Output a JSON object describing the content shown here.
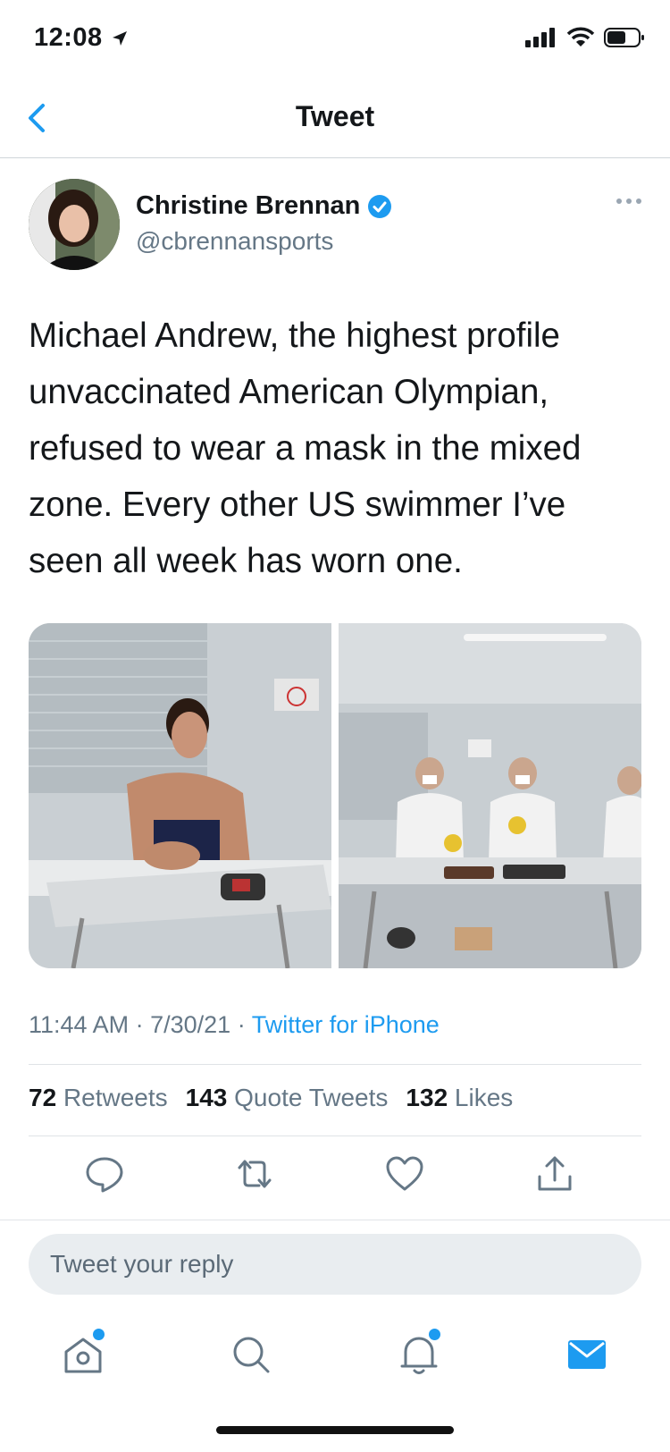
{
  "status_bar": {
    "time": "12:08"
  },
  "nav": {
    "title": "Tweet"
  },
  "author": {
    "name": "Christine Brennan",
    "handle": "@cbrennansports",
    "verified": true
  },
  "tweet": {
    "text": "Michael Andrew, the highest profile unvaccinated American Olympian, refused to wear a mask in the mixed zone. Every other US swimmer I’ve seen all week has worn one.",
    "images": [
      {
        "description": "swimmer-in-mixed-zone"
      },
      {
        "description": "masked-swimmers-with-medals"
      }
    ],
    "time": "11:44 AM",
    "date": "7/30/21",
    "source": "Twitter for iPhone"
  },
  "stats": {
    "retweets_count": "72",
    "retweets_label": "Retweets",
    "quotes_count": "143",
    "quotes_label": "Quote Tweets",
    "likes_count": "132",
    "likes_label": "Likes"
  },
  "reply": {
    "placeholder": "Tweet your reply"
  },
  "colors": {
    "accent": "#1d9bf0",
    "secondary_text": "#657786",
    "primary_text": "#14171a"
  },
  "icons": [
    "back-chevron-icon",
    "verified-icon",
    "more-icon",
    "reply-icon",
    "retweet-icon",
    "like-icon",
    "share-icon",
    "home-icon",
    "search-icon",
    "notifications-icon",
    "messages-icon"
  ]
}
